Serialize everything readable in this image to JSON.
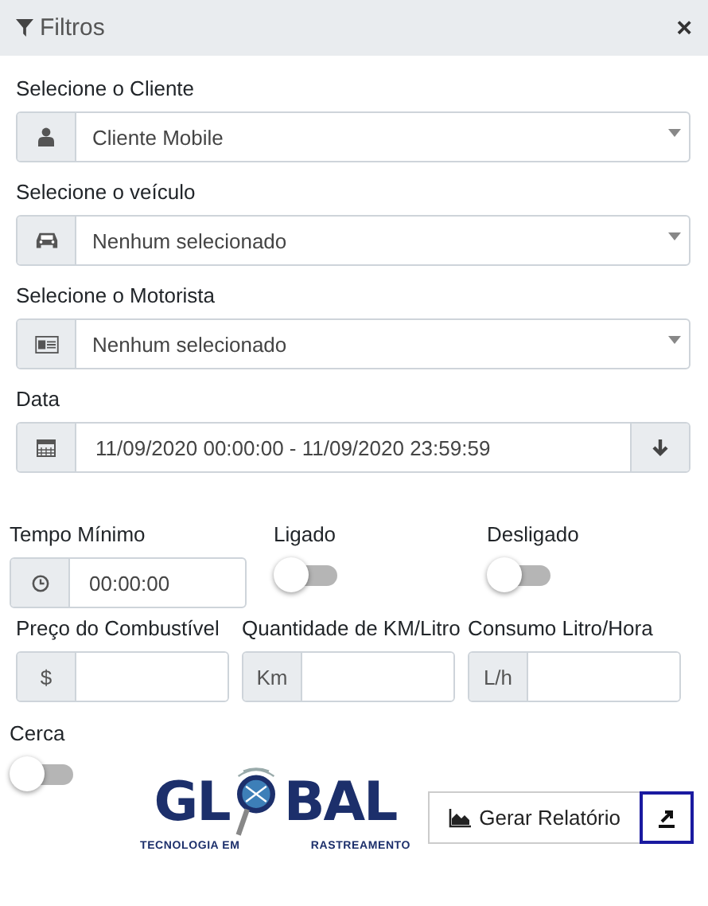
{
  "header": {
    "title": "Filtros",
    "close": "×"
  },
  "selects": [
    {
      "label": "Selecione o Cliente",
      "value": "Cliente Mobile"
    },
    {
      "label": "Selecione o veículo",
      "value": "Nenhum selecionado"
    },
    {
      "label": "Selecione o Motorista",
      "value": "Nenhum selecionado"
    }
  ],
  "date": {
    "label": "Data",
    "value": "11/09/2020 00:00:00 - 11/09/2020 23:59:59"
  },
  "min_time": {
    "label": "Tempo Mínimo",
    "value": "00:00:00"
  },
  "toggles": [
    {
      "label": "Ligado",
      "on": false
    },
    {
      "label": "Desligado",
      "on": false
    }
  ],
  "costs": [
    {
      "label": "Preço do Combustível",
      "addon": "$"
    },
    {
      "label": "Quantidade de KM/Litro",
      "addon": "Km"
    },
    {
      "label": "Consumo Litro/Hora",
      "addon": "L/h"
    }
  ],
  "fence": {
    "label": "Cerca",
    "on": false
  },
  "logo": {
    "left": "GL",
    "right": "BAL",
    "tagline_left": "TECNOLOGIA EM",
    "tagline_right": "RASTREAMENTO"
  },
  "report_button": "Gerar Relatório"
}
